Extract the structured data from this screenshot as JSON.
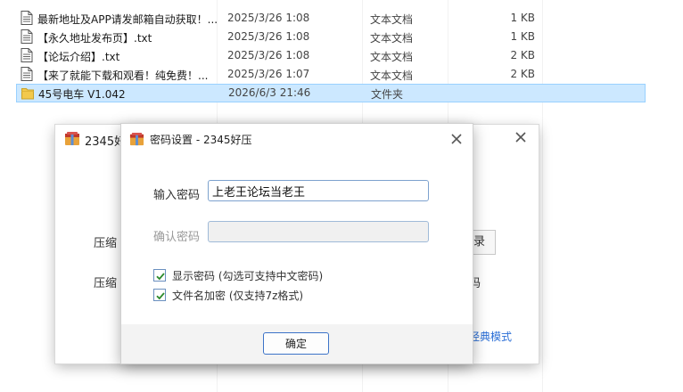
{
  "files": [
    {
      "name": "最新地址及APP请发邮箱自动获取！...",
      "date": "2025/3/26 1:08",
      "type": "文本文档",
      "size": "1 KB",
      "kind": "text-file",
      "selected": false
    },
    {
      "name": "【永久地址发布页】.txt",
      "date": "2025/3/26 1:08",
      "type": "文本文档",
      "size": "1 KB",
      "kind": "text-file",
      "selected": false
    },
    {
      "name": "【论坛介绍】.txt",
      "date": "2025/3/26 1:08",
      "type": "文本文档",
      "size": "2 KB",
      "kind": "text-file",
      "selected": false
    },
    {
      "name": "【来了就能下载和观看！纯免费！...",
      "date": "2025/3/26 1:07",
      "type": "文本文档",
      "size": "2 KB",
      "kind": "text-file",
      "selected": false
    },
    {
      "name": "45号电车 V1.042",
      "date": "2026/6/3 21:46",
      "type": "文件夹",
      "size": "",
      "kind": "folder",
      "selected": true
    }
  ],
  "back_window": {
    "title": "2345好",
    "label_1": "压缩",
    "label_2": "压缩",
    "browse_label": "录",
    "right_text": "码",
    "classic_mode_link": "经典模式"
  },
  "dialog": {
    "title": "密码设置 - 2345好压",
    "password_label": "输入密码",
    "password_value": "上老王论坛当老王",
    "confirm_label": "确认密码",
    "confirm_value": "",
    "show_password_label": "显示密码 (勾选可支持中文密码)",
    "show_password_checked": true,
    "encrypt_names_label": "文件名加密 (仅支持7z格式)",
    "encrypt_names_checked": true,
    "ok_label": "确定"
  },
  "colors": {
    "selection_bg": "#cce8ff",
    "selection_border": "#99d1ff",
    "input_border": "#7da2ce",
    "link": "#2a6ed6",
    "check": "#2e8b2e"
  }
}
